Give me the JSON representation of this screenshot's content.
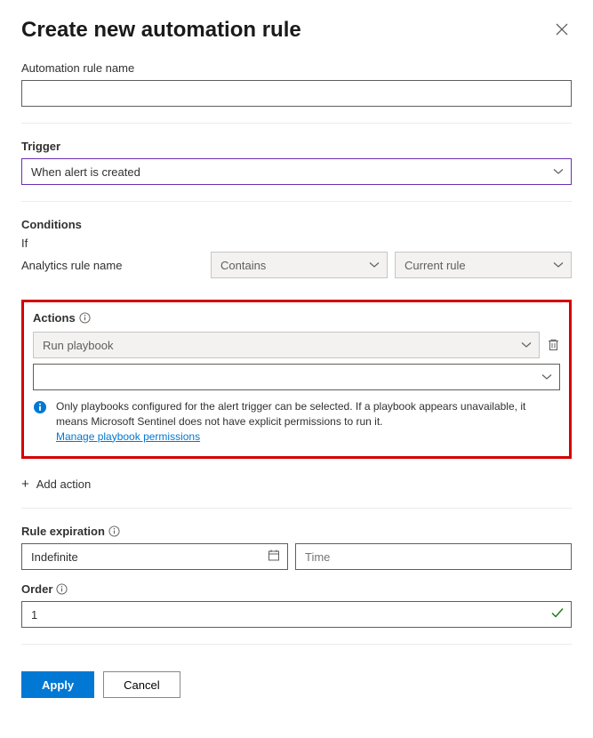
{
  "header": {
    "title": "Create new automation rule"
  },
  "rule_name": {
    "label": "Automation rule name",
    "value": ""
  },
  "trigger": {
    "label": "Trigger",
    "value": "When alert is created"
  },
  "conditions": {
    "label": "Conditions",
    "if_label": "If",
    "field_label": "Analytics rule name",
    "operator": "Contains",
    "value": "Current rule"
  },
  "actions": {
    "label": "Actions",
    "playbook_label": "Run playbook",
    "secondary_value": "",
    "info_text": "Only playbooks configured for the alert trigger can be selected. If a playbook appears unavailable, it means Microsoft Sentinel does not have explicit permissions to run it.",
    "manage_link": "Manage playbook permissions",
    "add_action": "Add action"
  },
  "expiration": {
    "label": "Rule expiration",
    "date_value": "Indefinite",
    "time_placeholder": "Time"
  },
  "order": {
    "label": "Order",
    "value": "1"
  },
  "footer": {
    "apply": "Apply",
    "cancel": "Cancel"
  }
}
